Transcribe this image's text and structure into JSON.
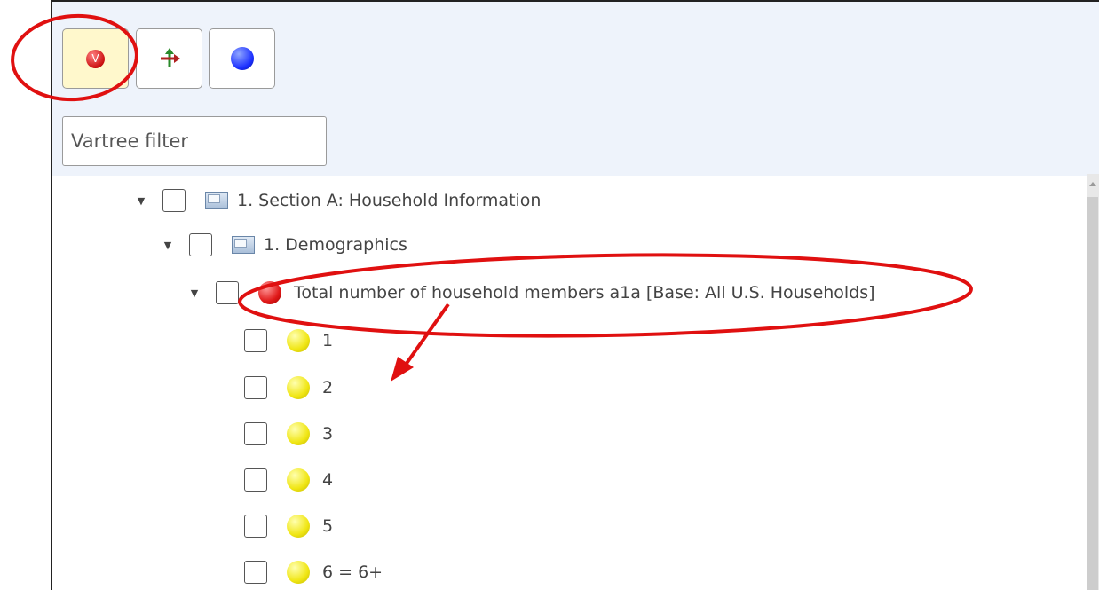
{
  "toolbar": {
    "buttons": [
      {
        "icon": "variable-icon",
        "glyph": "V",
        "active": true
      },
      {
        "icon": "move-arrows-icon",
        "active": false
      },
      {
        "icon": "blue-dot-icon",
        "active": false
      }
    ],
    "filter": {
      "placeholder": "Vartree filter",
      "value": ""
    }
  },
  "tree": {
    "section": {
      "label": "1. Section A: Household Information",
      "expanded": true,
      "checked": false
    },
    "folder": {
      "label": "1. Demographics",
      "expanded": true,
      "checked": false
    },
    "variable": {
      "label": "Total number of household members a1a [Base: All U.S. Households]",
      "expanded": true,
      "checked": false,
      "color": "#e01818"
    },
    "values": [
      {
        "label": "1"
      },
      {
        "label": "2"
      },
      {
        "label": "3"
      },
      {
        "label": "4"
      },
      {
        "label": "5"
      },
      {
        "label": "6 = 6+"
      }
    ],
    "value_color": "#f0e614"
  },
  "annotation_color": "#e01010"
}
